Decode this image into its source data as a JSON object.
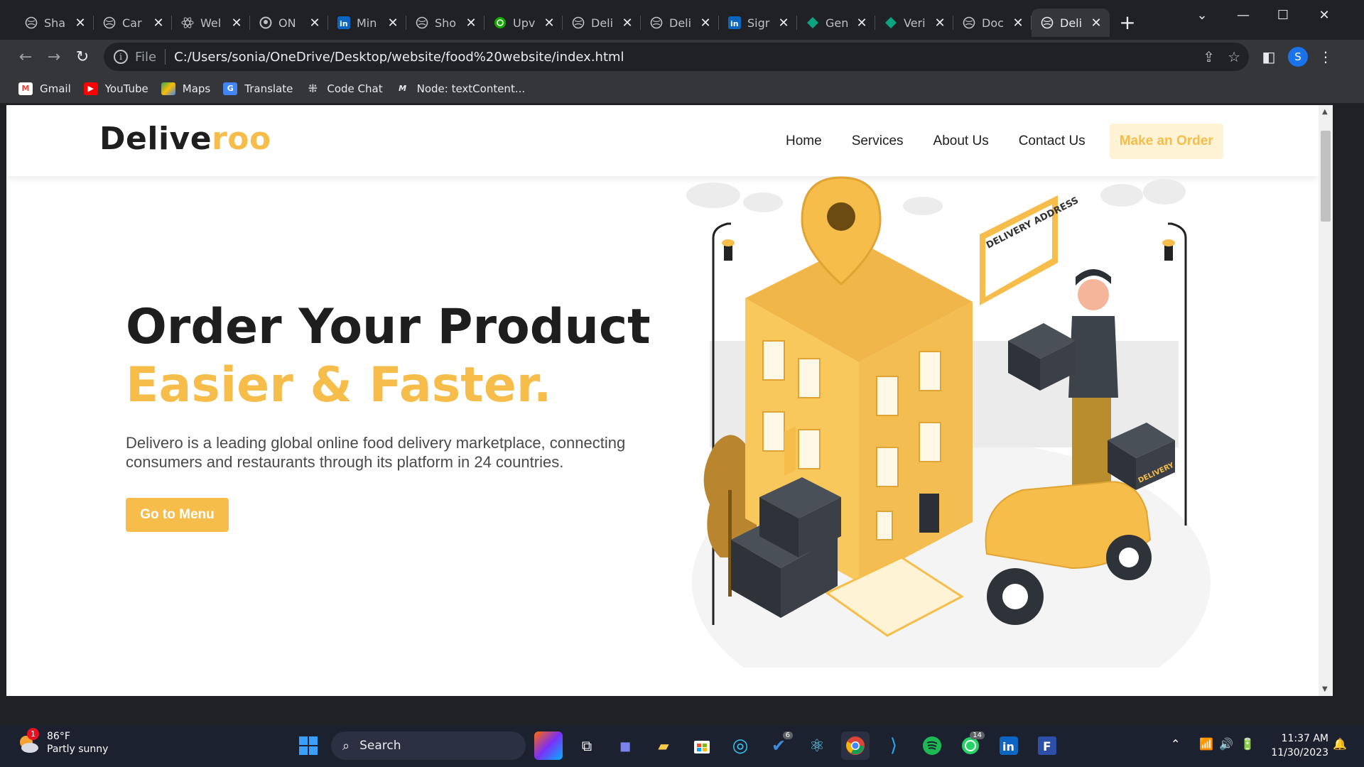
{
  "browser": {
    "tabs": [
      {
        "label": "Sha",
        "icon": "globe-icon"
      },
      {
        "label": "Car",
        "icon": "globe-icon"
      },
      {
        "label": "Wel",
        "icon": "react-icon"
      },
      {
        "label": "ON",
        "icon": "github-icon"
      },
      {
        "label": "Min",
        "icon": "linkedin-icon"
      },
      {
        "label": "Sho",
        "icon": "globe-icon"
      },
      {
        "label": "Upv",
        "icon": "upwork-icon"
      },
      {
        "label": "Deli",
        "icon": "globe-icon"
      },
      {
        "label": "Deli",
        "icon": "globe-icon"
      },
      {
        "label": "Sigr",
        "icon": "linkedin-icon"
      },
      {
        "label": "Gen",
        "icon": "gem-icon"
      },
      {
        "label": "Veri",
        "icon": "gem-icon"
      },
      {
        "label": "Doc",
        "icon": "globe-icon"
      },
      {
        "label": "Deli",
        "icon": "globe-icon",
        "active": true
      }
    ],
    "address": {
      "scheme": "File",
      "url": "C:/Users/sonia/OneDrive/Desktop/website/food%20website/index.html"
    },
    "profile_initial": "S",
    "bookmarks": [
      {
        "label": "Gmail",
        "color": "#ea4335"
      },
      {
        "label": "YouTube",
        "color": "#ff0000"
      },
      {
        "label": "Maps",
        "color": "#34a853"
      },
      {
        "label": "Translate",
        "color": "#4285f4"
      },
      {
        "label": "Code Chat",
        "color": "#9aa0a6"
      },
      {
        "label": "Node: textContent...",
        "color": "#202124"
      }
    ]
  },
  "site": {
    "logo_main": "Delive",
    "logo_accent": "roo",
    "nav": [
      "Home",
      "Services",
      "About Us",
      "Contact Us"
    ],
    "cta": "Make an Order",
    "hero": {
      "title_line1": "Order Your Product",
      "title_line2": "Easier & Faster.",
      "description": "Delivero is a leading global online food delivery marketplace, connecting consumers and restaurants through its platform in 24 countries.",
      "button": "Go to Menu"
    },
    "illustration": {
      "address_sign": "DELIVERY ADDRESS",
      "box_label": "DELIVERY"
    },
    "colors": {
      "accent": "#f7bd4b",
      "text": "#1e1e1e"
    }
  },
  "taskbar": {
    "weather_temp": "86°F",
    "weather_desc": "Partly sunny",
    "weather_badge": "1",
    "search_label": "Search",
    "todo_badge": "6",
    "whatsapp_badge": "14",
    "time": "11:37 AM",
    "date": "11/30/2023"
  }
}
